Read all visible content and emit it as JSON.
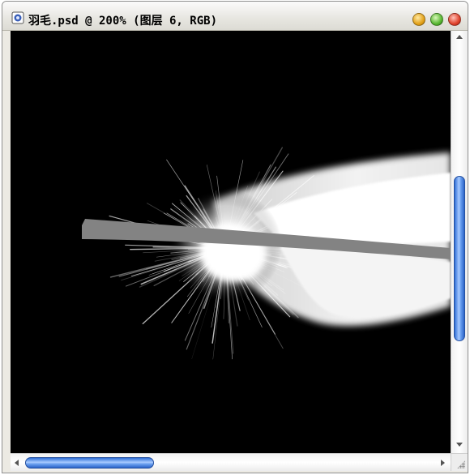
{
  "window": {
    "title": "羽毛.psd @ 200% (图层 6, RGB)",
    "icon": "photoshop-document-icon",
    "controls": [
      "minimize-button",
      "zoom-button",
      "close-button"
    ],
    "control_colors": {
      "minimize": "#e3a21a",
      "zoom": "#58b732",
      "close": "#e0432d"
    }
  },
  "canvas": {
    "background": "#000000",
    "content": "feather-artwork"
  },
  "scrollbars": {
    "vertical_thumb_position": 0.34,
    "vertical_thumb_size": 0.42,
    "horizontal_thumb_position": 0.0,
    "horizontal_thumb_size": 0.31,
    "accent": "#4a86e8"
  }
}
